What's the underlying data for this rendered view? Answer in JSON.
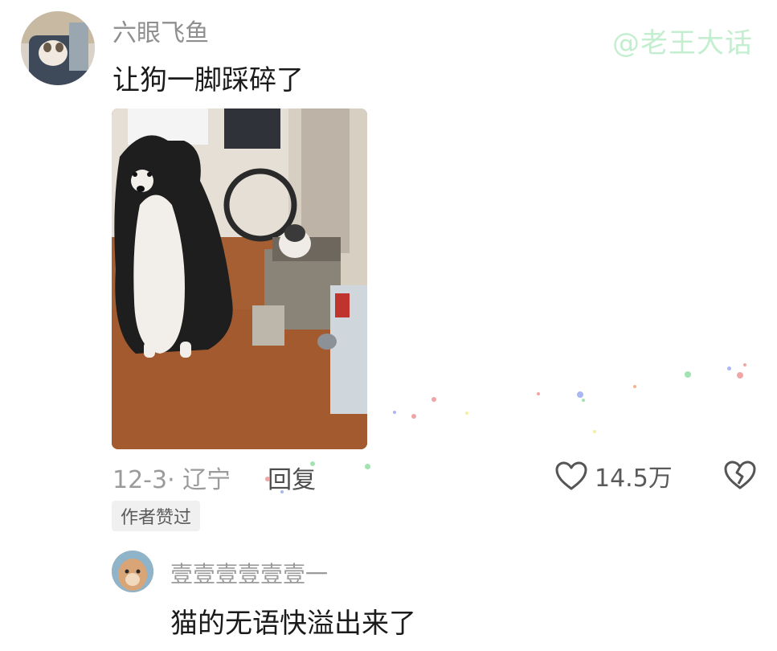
{
  "watermark": "@老王大话",
  "comment": {
    "username": "六眼飞鱼",
    "text": "让狗一脚踩碎了",
    "date_location": "12-3· 辽宁",
    "reply_label": "回复",
    "like_count": "14.5万",
    "author_liked_badge": "作者赞过"
  },
  "reply": {
    "username": "壹壹壹壹壹壹一",
    "text": "猫的无语快溢出来了"
  }
}
